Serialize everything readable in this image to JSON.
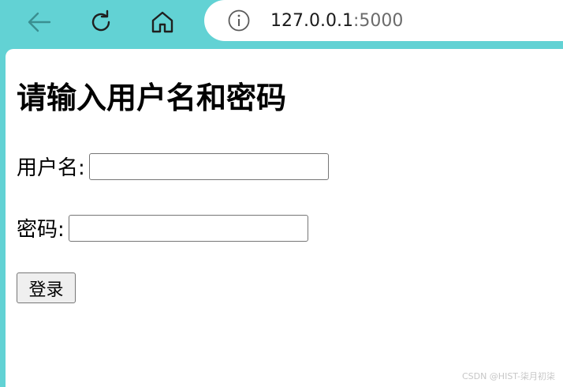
{
  "browser": {
    "url_host": "127.0.0.1",
    "url_port": ":5000",
    "icons": {
      "back": "arrow-left-icon",
      "reload": "refresh-icon",
      "home": "home-icon",
      "info": "info-icon"
    }
  },
  "page": {
    "heading": "请输入用户名和密码",
    "username_label": "用户名:",
    "username_value": "",
    "password_label": "密码:",
    "password_value": "",
    "login_button": "登录"
  },
  "watermark": "CSDN @HIST-柒月初柒",
  "colors": {
    "chrome_accent": "#62d2d4"
  }
}
